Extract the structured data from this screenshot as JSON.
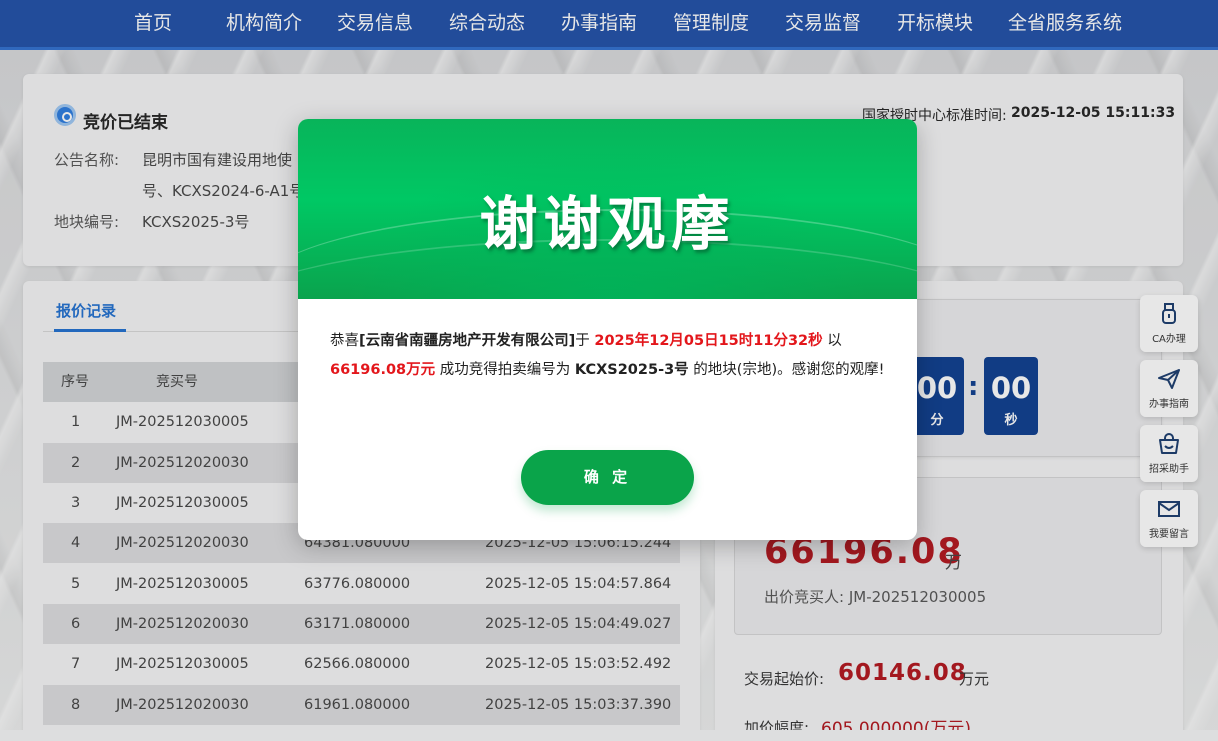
{
  "nav": {
    "items": [
      "首页",
      "机构简介",
      "交易信息",
      "综合动态",
      "办事指南",
      "管理制度",
      "交易监督",
      "开标模块",
      "全省服务系统"
    ]
  },
  "status": {
    "title": "竞价已结束",
    "announcement_label": "公告名称:",
    "announcement_line1": "昆明市国有建设用地使",
    "announcement_line2": "号、KCXS2024-6-A1号",
    "plot_label": "地块编号:",
    "plot_value": "KCXS2025-3号",
    "time_label": "国家授时中心标准时间:",
    "time_value": "2025-12-05 15:11:33"
  },
  "records": {
    "tab_label": "报价记录",
    "headers": [
      "序号",
      "竞买号"
    ],
    "rows": [
      {
        "no": "1",
        "bidder": "JM-202512030005",
        "amount": "",
        "time": ""
      },
      {
        "no": "2",
        "bidder": "JM-202512020030",
        "amount": "",
        "time": ""
      },
      {
        "no": "3",
        "bidder": "JM-202512030005",
        "amount": "",
        "time": ""
      },
      {
        "no": "4",
        "bidder": "JM-202512020030",
        "amount": "64381.080000",
        "time": "2025-12-05 15:06:15.244"
      },
      {
        "no": "5",
        "bidder": "JM-202512030005",
        "amount": "63776.080000",
        "time": "2025-12-05 15:04:57.864"
      },
      {
        "no": "6",
        "bidder": "JM-202512020030",
        "amount": "63171.080000",
        "time": "2025-12-05 15:04:49.027"
      },
      {
        "no": "7",
        "bidder": "JM-202512030005",
        "amount": "62566.080000",
        "time": "2025-12-05 15:03:52.492"
      },
      {
        "no": "8",
        "bidder": "JM-202512020030",
        "amount": "61961.080000",
        "time": "2025-12-05 15:03:37.390"
      }
    ]
  },
  "countdown": {
    "minutes": "00",
    "minutes_unit": "分",
    "seconds": "00",
    "seconds_unit": "秒",
    "separator": ":"
  },
  "price": {
    "current": "66196.08",
    "current_unit": "万",
    "buyer": "出价竞买人: JM-202512030005",
    "start_label": "交易起始价:",
    "start_value": "60146.08",
    "start_unit": "万元",
    "increment_label": "加价幅度:",
    "increment_value": "605.000000(万元)"
  },
  "side_tools": [
    {
      "label": "CA办理",
      "icon": "usb-key-icon"
    },
    {
      "label": "办事指南",
      "icon": "paper-plane-icon"
    },
    {
      "label": "招采助手",
      "icon": "shopping-bag-icon"
    },
    {
      "label": "我要留言",
      "icon": "mail-icon"
    }
  ],
  "modal": {
    "banner_title": "谢谢观摩",
    "msg_prefix": "恭喜",
    "company": "[云南省南疆房地产开发有限公司]",
    "msg_at": "于",
    "datetime": "2025年12月05日15时11分32秒",
    "msg_with": "以",
    "amount": "66196.08万元",
    "msg_success": "成功竞得拍卖编号为",
    "lot": "KCXS2025-3号",
    "msg_suffix": "的地块(宗地)。感谢您的观摩!",
    "confirm_label": "确 定"
  },
  "colors": {
    "nav_bg": "#1f4fa8",
    "accent_blue": "#1f6fd0",
    "countdown_bg": "#0c3d8f",
    "price_red": "#b2141c",
    "modal_green": "#0aa44a",
    "highlight_red": "#e3161b"
  }
}
